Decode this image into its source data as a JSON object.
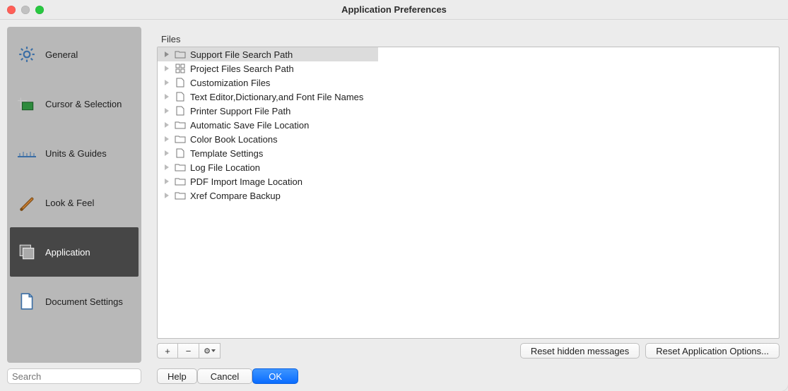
{
  "window": {
    "title": "Application Preferences"
  },
  "sidebar": {
    "search_placeholder": "Search",
    "items": [
      {
        "id": "general",
        "label": "General",
        "selected": false,
        "icon": "gear"
      },
      {
        "id": "cursor-selection",
        "label": "Cursor & Selection",
        "selected": false,
        "icon": "crosshair"
      },
      {
        "id": "units-guides",
        "label": "Units & Guides",
        "selected": false,
        "icon": "ruler"
      },
      {
        "id": "look-feel",
        "label": "Look & Feel",
        "selected": false,
        "icon": "brush"
      },
      {
        "id": "application",
        "label": "Application",
        "selected": true,
        "icon": "window-stack"
      },
      {
        "id": "document-settings",
        "label": "Document Settings",
        "selected": false,
        "icon": "document"
      }
    ]
  },
  "main": {
    "section_label": "Files",
    "tree": [
      {
        "label": "Support File Search Path",
        "icon": "folder",
        "selected": true
      },
      {
        "label": "Project Files Search Path",
        "icon": "grid",
        "selected": false
      },
      {
        "label": "Customization Files",
        "icon": "page",
        "selected": false
      },
      {
        "label": "Text Editor,Dictionary,and Font File Names",
        "icon": "page",
        "selected": false
      },
      {
        "label": "Printer Support File Path",
        "icon": "page",
        "selected": false
      },
      {
        "label": "Automatic Save File Location",
        "icon": "folder",
        "selected": false
      },
      {
        "label": "Color Book Locations",
        "icon": "folder",
        "selected": false
      },
      {
        "label": "Template Settings",
        "icon": "page",
        "selected": false
      },
      {
        "label": "Log File Location",
        "icon": "folder",
        "selected": false
      },
      {
        "label": "PDF Import Image Location",
        "icon": "folder",
        "selected": false
      },
      {
        "label": "Xref Compare Backup",
        "icon": "folder",
        "selected": false
      }
    ],
    "toolbar": {
      "add_label": "+",
      "remove_label": "−",
      "gear_label": "⚙"
    },
    "actions": {
      "reset_hidden": "Reset hidden messages",
      "reset_app_options": "Reset Application Options..."
    }
  },
  "footer": {
    "help": "Help",
    "cancel": "Cancel",
    "ok": "OK"
  }
}
